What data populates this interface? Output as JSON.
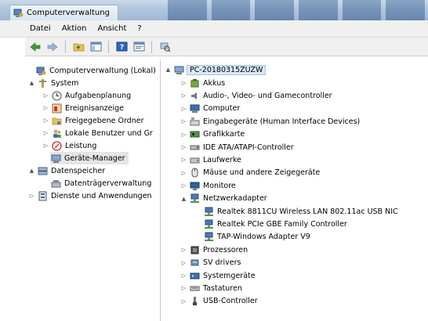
{
  "window": {
    "title": "Computerverwaltung"
  },
  "menu": [
    "Datei",
    "Aktion",
    "Ansicht",
    "?"
  ],
  "left_tree": [
    {
      "label": "Computerverwaltung (Lokal)",
      "icon": "computer-management-icon",
      "level": 0,
      "twisty": ""
    },
    {
      "label": "System",
      "icon": "tools-icon",
      "level": 1,
      "twisty": "▲"
    },
    {
      "label": "Aufgabenplanung",
      "icon": "clock-icon",
      "level": 2,
      "twisty": "▷"
    },
    {
      "label": "Ereignisanzeige",
      "icon": "event-viewer-icon",
      "level": 2,
      "twisty": "▷"
    },
    {
      "label": "Freigegebene Ordner",
      "icon": "shared-folder-icon",
      "level": 2,
      "twisty": "▷"
    },
    {
      "label": "Lokale Benutzer und Gr",
      "icon": "users-icon",
      "level": 2,
      "twisty": "▷"
    },
    {
      "label": "Leistung",
      "icon": "performance-icon",
      "level": 2,
      "twisty": "▷"
    },
    {
      "label": "Geräte-Manager",
      "icon": "device-manager-icon",
      "level": 2,
      "twisty": "",
      "selected": true
    },
    {
      "label": "Datenspeicher",
      "icon": "storage-icon",
      "level": 1,
      "twisty": "▲"
    },
    {
      "label": "Datenträgerverwaltung",
      "icon": "disk-management-icon",
      "level": 2,
      "twisty": ""
    },
    {
      "label": "Dienste und Anwendungen",
      "icon": "services-icon",
      "level": 1,
      "twisty": "▷"
    }
  ],
  "device_tree": {
    "root": "PC-20180315ZUZW",
    "items": [
      {
        "label": "Akkus",
        "icon": "battery-icon",
        "twisty": "▷",
        "level": 1
      },
      {
        "label": "Audio-, Video- und Gamecontroller",
        "icon": "speaker-icon",
        "twisty": "▷",
        "level": 1
      },
      {
        "label": "Computer",
        "icon": "computer-icon",
        "twisty": "▷",
        "level": 1
      },
      {
        "label": "Eingabegeräte (Human Interface Devices)",
        "icon": "hid-icon",
        "twisty": "▷",
        "level": 1
      },
      {
        "label": "Grafikkarte",
        "icon": "display-adapter-icon",
        "twisty": "▷",
        "level": 1
      },
      {
        "label": "IDE ATA/ATAPI-Controller",
        "icon": "ide-controller-icon",
        "twisty": "▷",
        "level": 1
      },
      {
        "label": "Laufwerke",
        "icon": "drive-icon",
        "twisty": "▷",
        "level": 1
      },
      {
        "label": "Mäuse und andere Zeigegeräte",
        "icon": "mouse-icon",
        "twisty": "▷",
        "level": 1
      },
      {
        "label": "Monitore",
        "icon": "monitor-icon",
        "twisty": "▷",
        "level": 1
      },
      {
        "label": "Netzwerkadapter",
        "icon": "network-adapter-icon",
        "twisty": "▲",
        "level": 1
      },
      {
        "label": "Realtek 8811CU Wireless LAN 802.11ac USB NIC",
        "icon": "network-adapter-icon",
        "twisty": "",
        "level": 2
      },
      {
        "label": "Realtek PCIe GBE Family Controller",
        "icon": "network-adapter-icon",
        "twisty": "",
        "level": 2
      },
      {
        "label": "TAP-Windows Adapter V9",
        "icon": "network-adapter-icon",
        "twisty": "",
        "level": 2
      },
      {
        "label": "Prozessoren",
        "icon": "processor-icon",
        "twisty": "▷",
        "level": 1
      },
      {
        "label": "SV drivers",
        "icon": "driver-icon",
        "twisty": "▷",
        "level": 1
      },
      {
        "label": "Systemgeräte",
        "icon": "system-devices-icon",
        "twisty": "▷",
        "level": 1
      },
      {
        "label": "Tastaturen",
        "icon": "keyboard-icon",
        "twisty": "▷",
        "level": 1
      },
      {
        "label": "USB-Controller",
        "icon": "usb-icon",
        "twisty": "▷",
        "level": 1
      }
    ]
  },
  "toolbar_icons": [
    "back-arrow-icon",
    "forward-arrow-icon",
    "up-folder-icon",
    "show-hide-tree-icon",
    "help-icon",
    "properties-icon",
    "scan-hardware-icon"
  ]
}
